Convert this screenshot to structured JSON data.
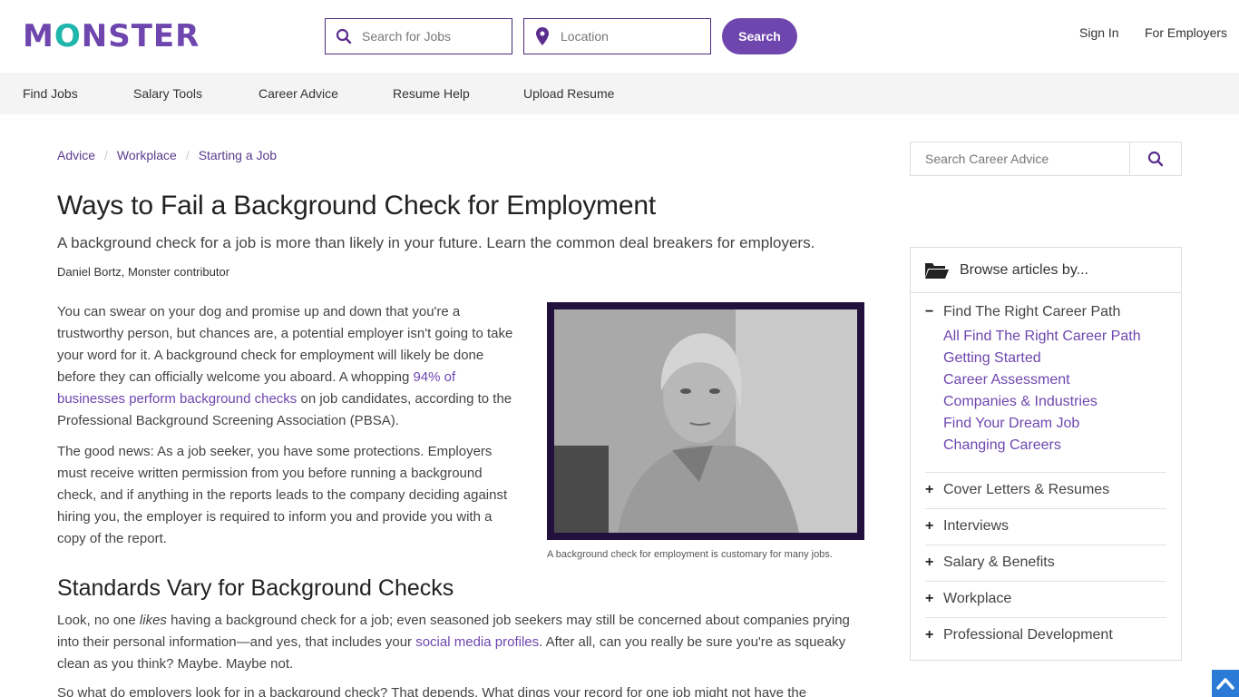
{
  "header": {
    "logo": {
      "part1": "M",
      "o": "O",
      "part2": "NSTER"
    },
    "search_jobs_placeholder": "Search for Jobs",
    "location_placeholder": "Location",
    "search_button": "Search",
    "sign_in": "Sign In",
    "for_employers": "For Employers"
  },
  "nav": {
    "items": [
      "Find Jobs",
      "Salary Tools",
      "Career Advice",
      "Resume Help",
      "Upload Resume"
    ]
  },
  "breadcrumb": [
    "Advice",
    "Workplace",
    "Starting a Job"
  ],
  "article": {
    "title": "Ways to Fail a Background Check for Employment",
    "subtitle": "A background check for a job is more than likely in your future. Learn the common deal breakers for employers.",
    "author": "Daniel Bortz, Monster contributor",
    "p1_before": "You can swear on your dog and promise up and down that you're a trustworthy person, but chances are, a potential employer isn't going to take your word for it. A background check for employment will likely be done before they can officially welcome you aboard. A whopping ",
    "p1_link": "94% of businesses perform background checks",
    "p1_after": " on job candidates, according to the Professional Background Screening Association (PBSA).",
    "p2": "The good news: As a job seeker, you have some protections. Employers must receive written permission from you before running a background check, and if anything in the reports leads to the company deciding against hiring you, the employer is required to inform you and provide you with a copy of the report.",
    "figure_caption": "A background check for employment is customary for many jobs.",
    "h2": "Standards Vary for Background Checks",
    "p3_before": "Look, no one ",
    "p3_em": "likes",
    "p3_mid": " having a background check for a job; even seasoned job seekers may still be concerned about companies prying into their personal information—and yes, that includes your ",
    "p3_link": "social media profiles",
    "p3_after": ". After all, can you really be sure you're as squeaky clean as you think? Maybe. Maybe not.",
    "p4": "So what do employers look for in a background check? That depends. What dings your record for one job might not have the"
  },
  "sidebar": {
    "search_placeholder": "Search Career Advice",
    "browse_title": "Browse articles by...",
    "expanded": {
      "label": "Find The Right Career Path",
      "toggle": "−",
      "items": [
        "All Find The Right Career Path",
        "Getting Started",
        "Career Assessment",
        "Companies & Industries",
        "Find Your Dream Job",
        "Changing Careers"
      ]
    },
    "collapsed": [
      {
        "label": "Cover Letters & Resumes",
        "toggle": "+"
      },
      {
        "label": "Interviews",
        "toggle": "+"
      },
      {
        "label": "Salary & Benefits",
        "toggle": "+"
      },
      {
        "label": "Workplace",
        "toggle": "+"
      },
      {
        "label": "Professional Development",
        "toggle": "+"
      }
    ]
  },
  "colors": {
    "brand_purple": "#6e46ae",
    "brand_teal": "#1fb6ac",
    "scroll_top_blue": "#2b7bd6"
  }
}
